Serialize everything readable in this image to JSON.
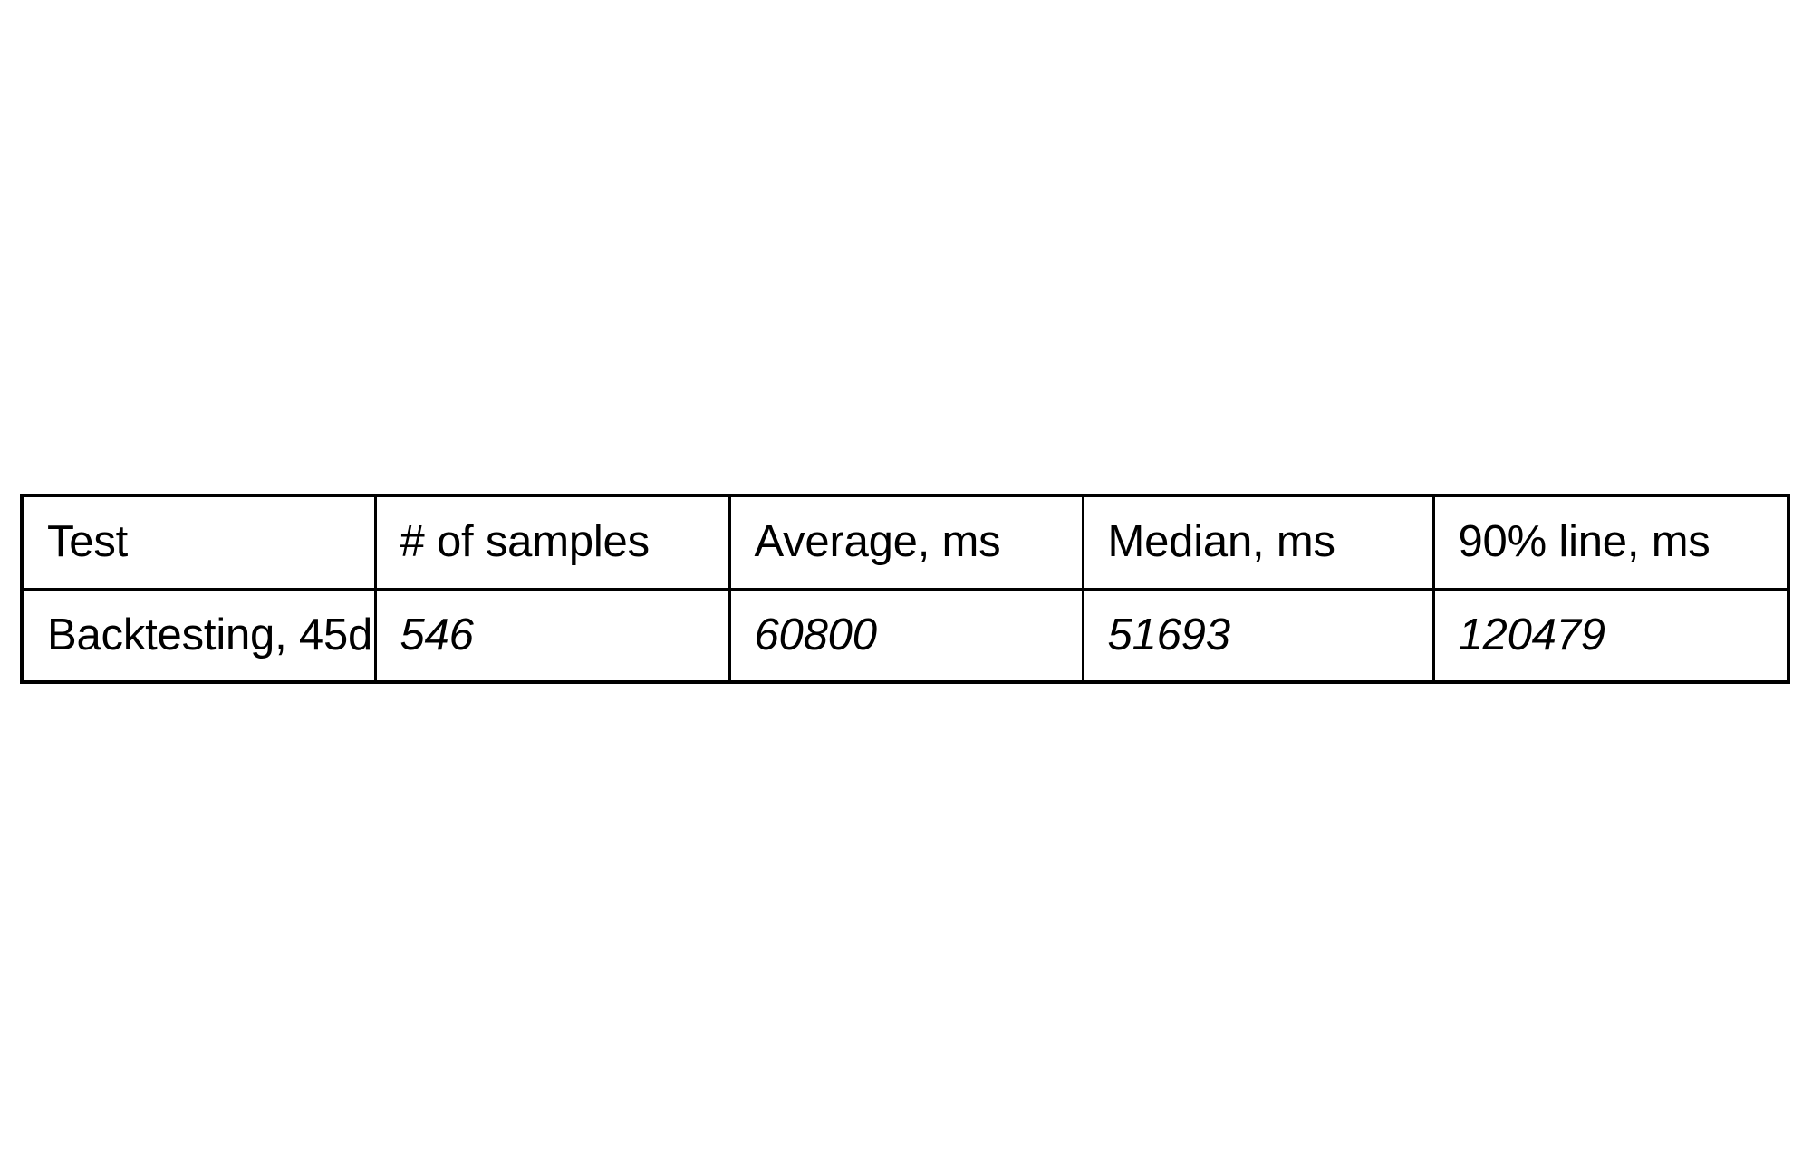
{
  "page": {
    "background_color": "#ffffff",
    "text_color": "#000000",
    "border_color": "#000000"
  },
  "table": {
    "name": "performance-results-table",
    "columns": [
      {
        "key": "test",
        "label": "Test"
      },
      {
        "key": "samples",
        "label": "# of samples"
      },
      {
        "key": "average",
        "label": "Average, ms"
      },
      {
        "key": "median",
        "label": "Median, ms"
      },
      {
        "key": "p90",
        "label": "90% line, ms"
      }
    ],
    "rows": [
      {
        "test": "Backtesting, 45d",
        "samples": "546",
        "average": "60800",
        "median": "51693",
        "p90": "120479"
      }
    ]
  },
  "chart_data": {
    "type": "table",
    "title": "",
    "columns": [
      "Test",
      "# of samples",
      "Average, ms",
      "Median, ms",
      "90% line, ms"
    ],
    "rows": [
      [
        "Backtesting, 45d",
        546,
        60800,
        51693,
        120479
      ]
    ]
  }
}
